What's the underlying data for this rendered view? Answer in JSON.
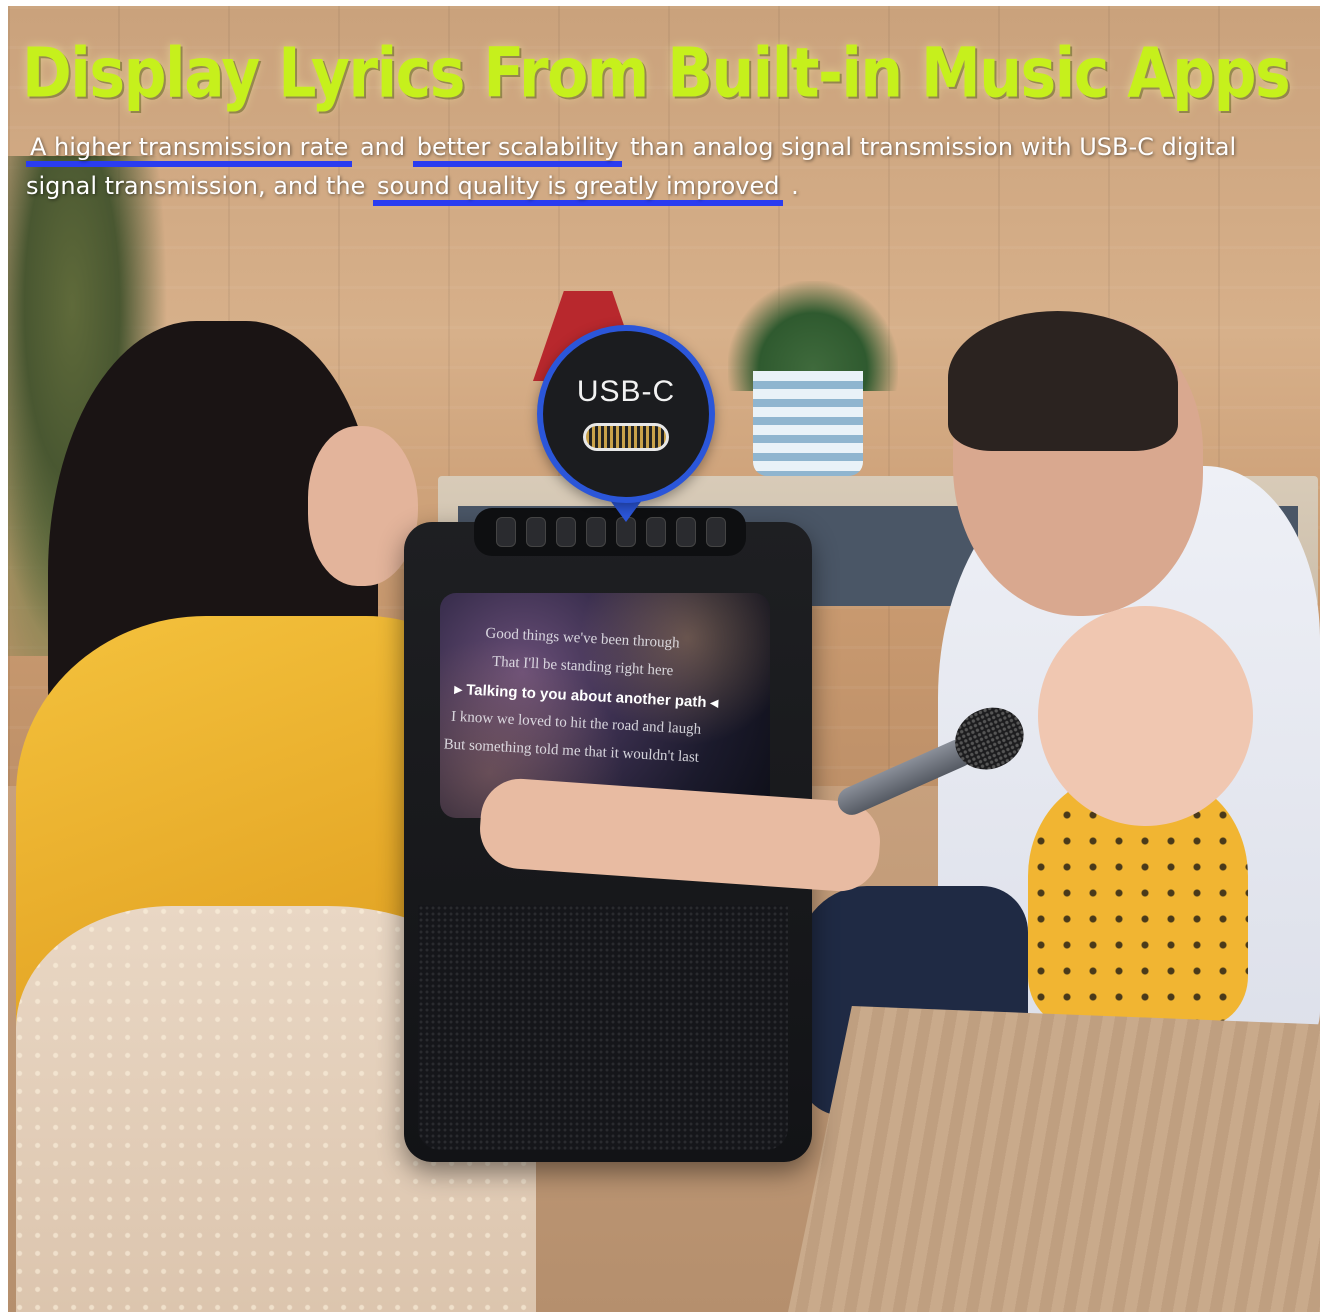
{
  "headline": "Display Lyrics From Built-in Music Apps",
  "subtext": {
    "hl_1": "A higher transmission rate",
    "plain_1": " and ",
    "hl_2": "better scalability",
    "plain_2": " than analog signal transmission with USB-C digital signal transmission, and the ",
    "hl_3": "sound quality is greatly improved",
    "plain_3": " ."
  },
  "callout": {
    "label": "USB-C",
    "border_color": "#2b56d9",
    "icon": "usb-c-port-icon"
  },
  "screen": {
    "lyrics": [
      "Good things we've been through",
      "That I'll be standing right here",
      "Talking to you about another path",
      "I know we loved to hit the road and laugh",
      "But something told me that it wouldn't last"
    ],
    "active_marker_left": "▸",
    "active_marker_right": "◂"
  },
  "colors": {
    "headline": "#c6f01c",
    "highlight_underline": "#2a3cf0"
  }
}
